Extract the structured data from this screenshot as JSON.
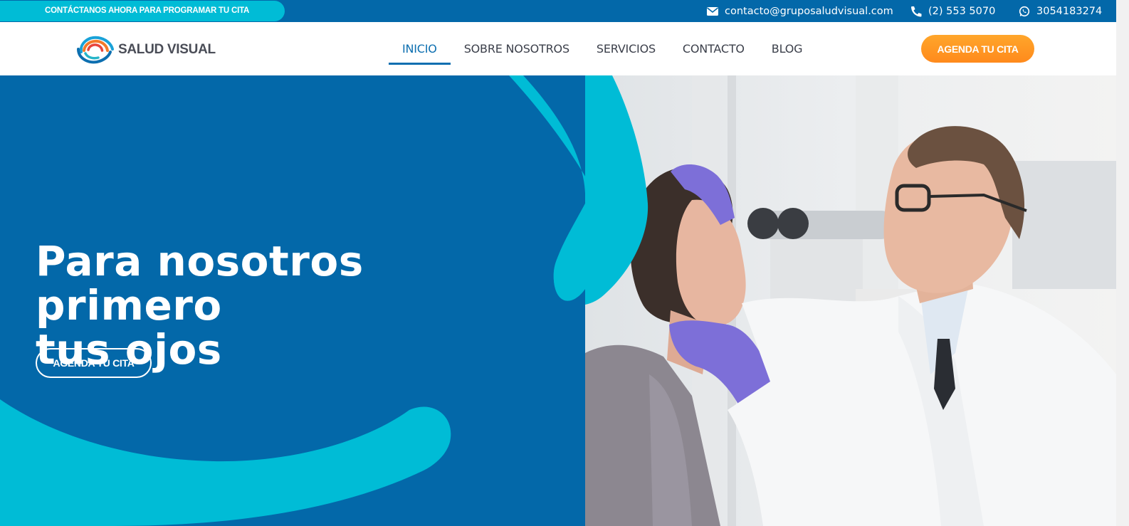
{
  "topbar": {
    "cta_text": "CONTÁCTANOS AHORA PARA PROGRAMAR TU CITA",
    "email": "contacto@gruposaludvisual.com",
    "phone": "(2) 553 5070",
    "whatsapp": "3054183274",
    "icons": [
      "envelope-icon",
      "phone-icon",
      "whatsapp-icon"
    ]
  },
  "header": {
    "logo_text": "SALUD VISUAL",
    "nav": [
      {
        "label": "INICIO",
        "active": true
      },
      {
        "label": "SOBRE NOSOTROS",
        "active": false
      },
      {
        "label": "SERVICIOS",
        "active": false
      },
      {
        "label": "CONTACTO",
        "active": false
      },
      {
        "label": "BLOG",
        "active": false
      }
    ],
    "cta_label": "AGENDA TU CITA"
  },
  "hero": {
    "title_line1": "Para nosotros primero",
    "title_line2": "tus ojos",
    "cta_label": "AGENDA TU CITA"
  },
  "colors": {
    "primary_blue": "#0368a9",
    "cyan_accent": "#00bcd6",
    "orange_cta": "#ff9420",
    "nav_active": "#0d6fb0"
  }
}
